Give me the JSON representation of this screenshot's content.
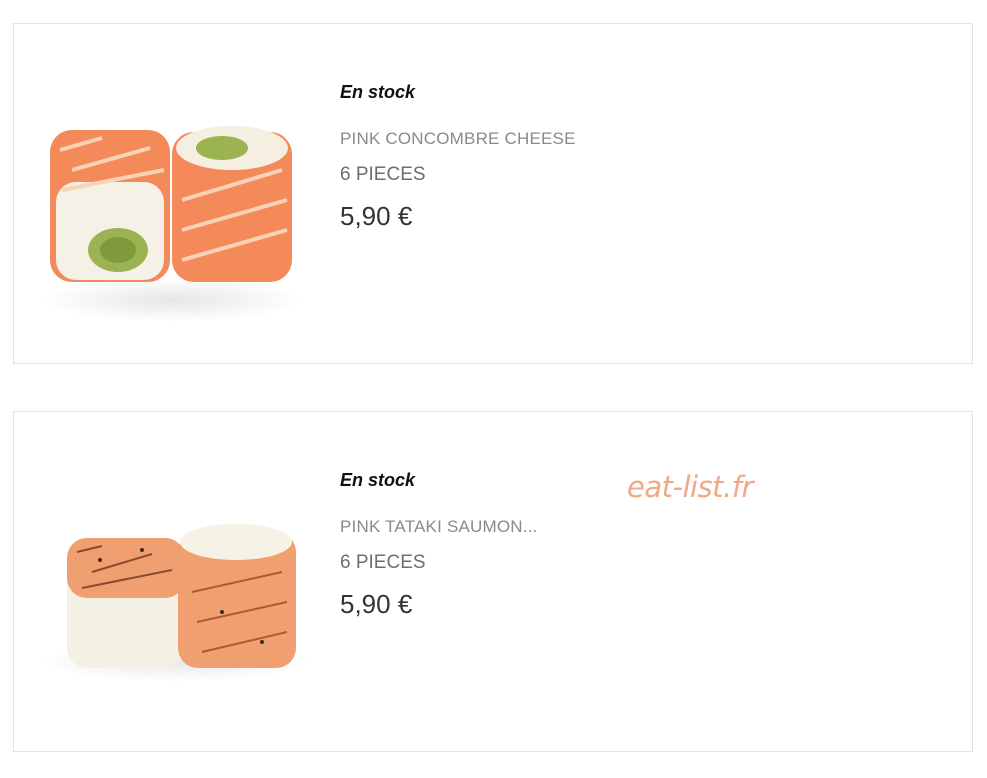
{
  "products": [
    {
      "stock": "En stock",
      "name": "PINK CONCOMBRE CHEESE",
      "pieces": "6 PIECES",
      "price": "5,90 €"
    },
    {
      "stock": "En stock",
      "name": "PINK TATAKI SAUMON...",
      "pieces": "6 PIECES",
      "price": "5,90 €"
    }
  ],
  "watermark": "eat-list.fr"
}
